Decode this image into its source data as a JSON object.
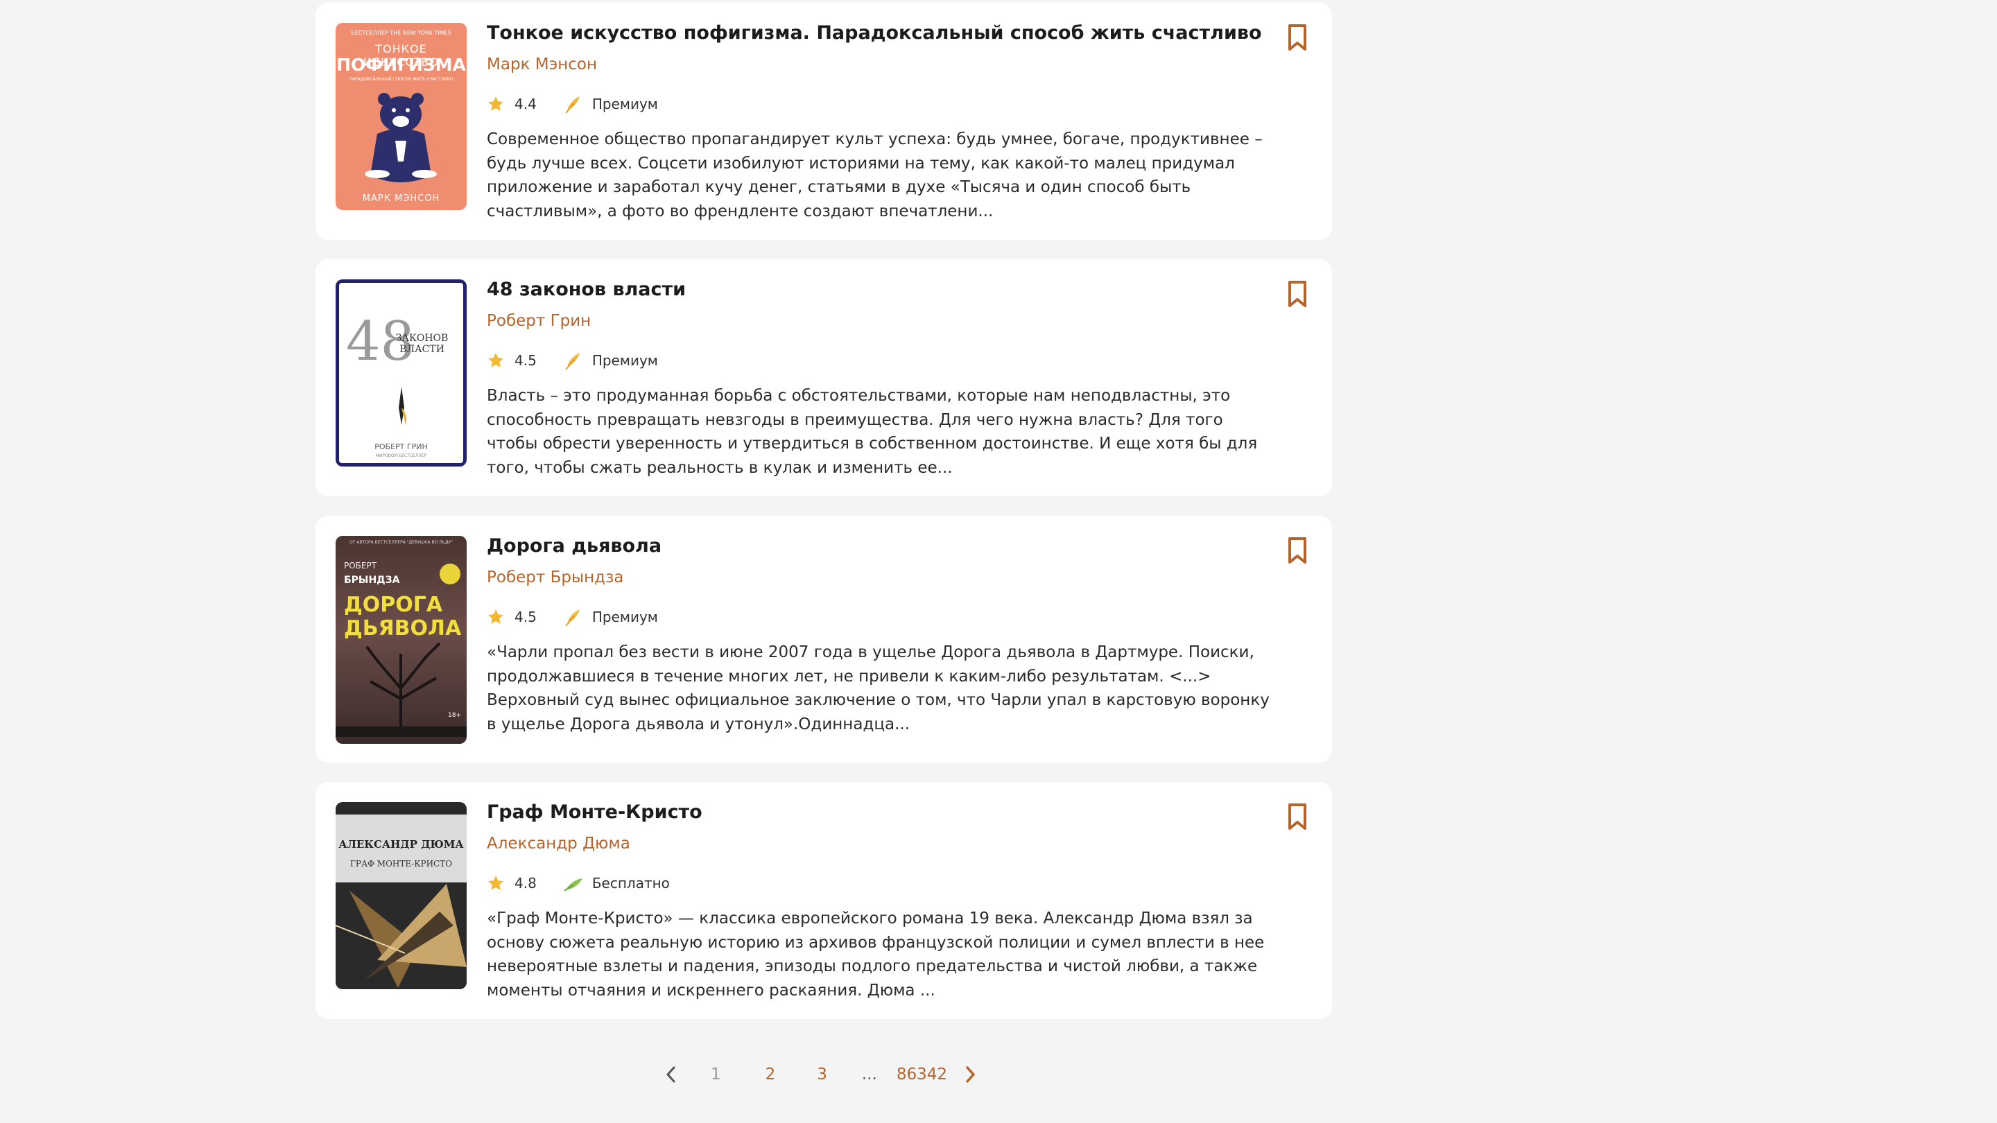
{
  "books": [
    {
      "title": "Тонкое искусство пофигизма. Парадоксальный способ жить счастливо",
      "author": "Марк Мэнсон",
      "rating": "4.4",
      "access": "Премиум",
      "description": "Современное общество пропагандирует культ успеха: будь умнее, богаче, продуктивнее – будь лучше всех. Соцсети изобилуют историями на тему, как какой-то малец придумал приложение и заработал кучу денег, статьями в духе «Тысяча и один способ быть счастливым», а фото во френдленте создают впечатлени...",
      "cover": {
        "top_line": "БЕСТСЕЛЛЕР THE NEW YORK TIMES",
        "line1": "ТОНКОЕ ИСКУССТВО",
        "line2": "ПОФИГИЗМА",
        "line3": "ПАРАДОКСАЛЬНЫЙ СПОСОБ ЖИТЬ СЧАСТЛИВО",
        "author": "МАРК МЭНСОН"
      }
    },
    {
      "title": "48 законов власти",
      "author": "Роберт Грин",
      "rating": "4.5",
      "access": "Премиум",
      "description": "Власть – это продуманная борьба с обстоятельствами, которые нам неподвластны, это способность превращать невзгоды в преимущества. Для чего нужна власть? Для того чтобы обрести уверенность и утвердиться в собственном достоинстве. И еще хотя бы для того, чтобы сжать реальность в кулак и изменить ее...",
      "cover": {
        "number": "48",
        "line1": "ЗАКОНОВ",
        "line2": "ВЛАСТИ",
        "author": "РОБЕРТ ГРИН",
        "bottom": "МИРОВОЙ БЕСТСЕЛЛЕР"
      }
    },
    {
      "title": "Дорога дьявола",
      "author": "Роберт Брындза",
      "rating": "4.5",
      "access": "Премиум",
      "description": "«Чарли пропал без вести в июне 2007 года в ущелье Дорога дьявола в Дартмуре. Поиски, продолжавшиеся в течение многих лет, не привели к каким-либо результатам. <...> Верховный суд вынес официальное заключение о том, что Чарли упал в карстовую воронку в ущелье Дорога дьявола и утонул».Одиннадца...",
      "cover": {
        "top_line": "ОТ АВТОРА БЕСТСЕЛЛЕРА \"ДЕВУШКА ВО ЛЬДУ\"",
        "author1": "РОБЕРТ",
        "author2": "БРЫНДЗА",
        "line1": "ДОРОГА",
        "line2": "ДЬЯВОЛА",
        "age": "18+"
      }
    },
    {
      "title": "Граф Монте-Кристо",
      "author": "Александр Дюма",
      "rating": "4.8",
      "access": "Бесплатно",
      "description": "«Граф Монте-Кристо» — классика европейского романа 19 века. Александр Дюма взял за основу сюжета реальную историю из архивов французской полиции и сумел вплести в нее невероятные взлеты и падения, эпизоды подлого предательства и чистой любви, а также моменты отчаяния и искреннего раскаяния. Дюма ...",
      "cover": {
        "author": "АЛЕКСАНДР ДЮМА",
        "line1": "ГРАФ МОНТЕ-КРИСТО"
      }
    }
  ],
  "pagination": {
    "pages": [
      "1",
      "2",
      "3"
    ],
    "ellipsis": "...",
    "last": "86342",
    "current": "1"
  },
  "icons": {
    "star": "star-icon",
    "premium": "premium-feather-icon",
    "free": "free-feather-icon",
    "bookmark": "bookmark-icon",
    "prev": "chevron-left-icon",
    "next": "chevron-right-icon"
  },
  "colors": {
    "accent": "#b5652b",
    "star": "#f4b731",
    "premium": "#f2b63a",
    "free": "#8cc152"
  }
}
